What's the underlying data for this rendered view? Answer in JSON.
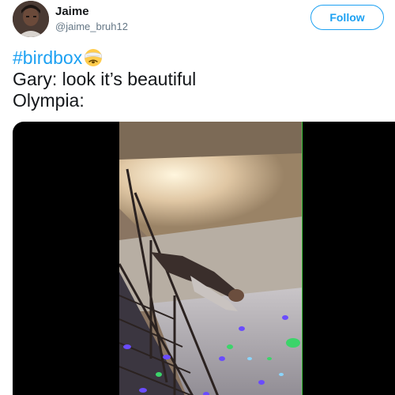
{
  "author": {
    "display_name": "Jaime",
    "handle": "@jaime_bruh12"
  },
  "follow_label": "Follow",
  "tweet": {
    "hashtag": "#birdbox",
    "emoji": "face-with-head-bandage-emoji",
    "line2": "Gary: look it’s beautiful",
    "line3": "Olympia:"
  },
  "colors": {
    "accent": "#1da1f2",
    "text": "#14171a",
    "secondary": "#657786",
    "media_background": "#000000"
  },
  "media": {
    "type": "video",
    "icon": "video-frame"
  }
}
